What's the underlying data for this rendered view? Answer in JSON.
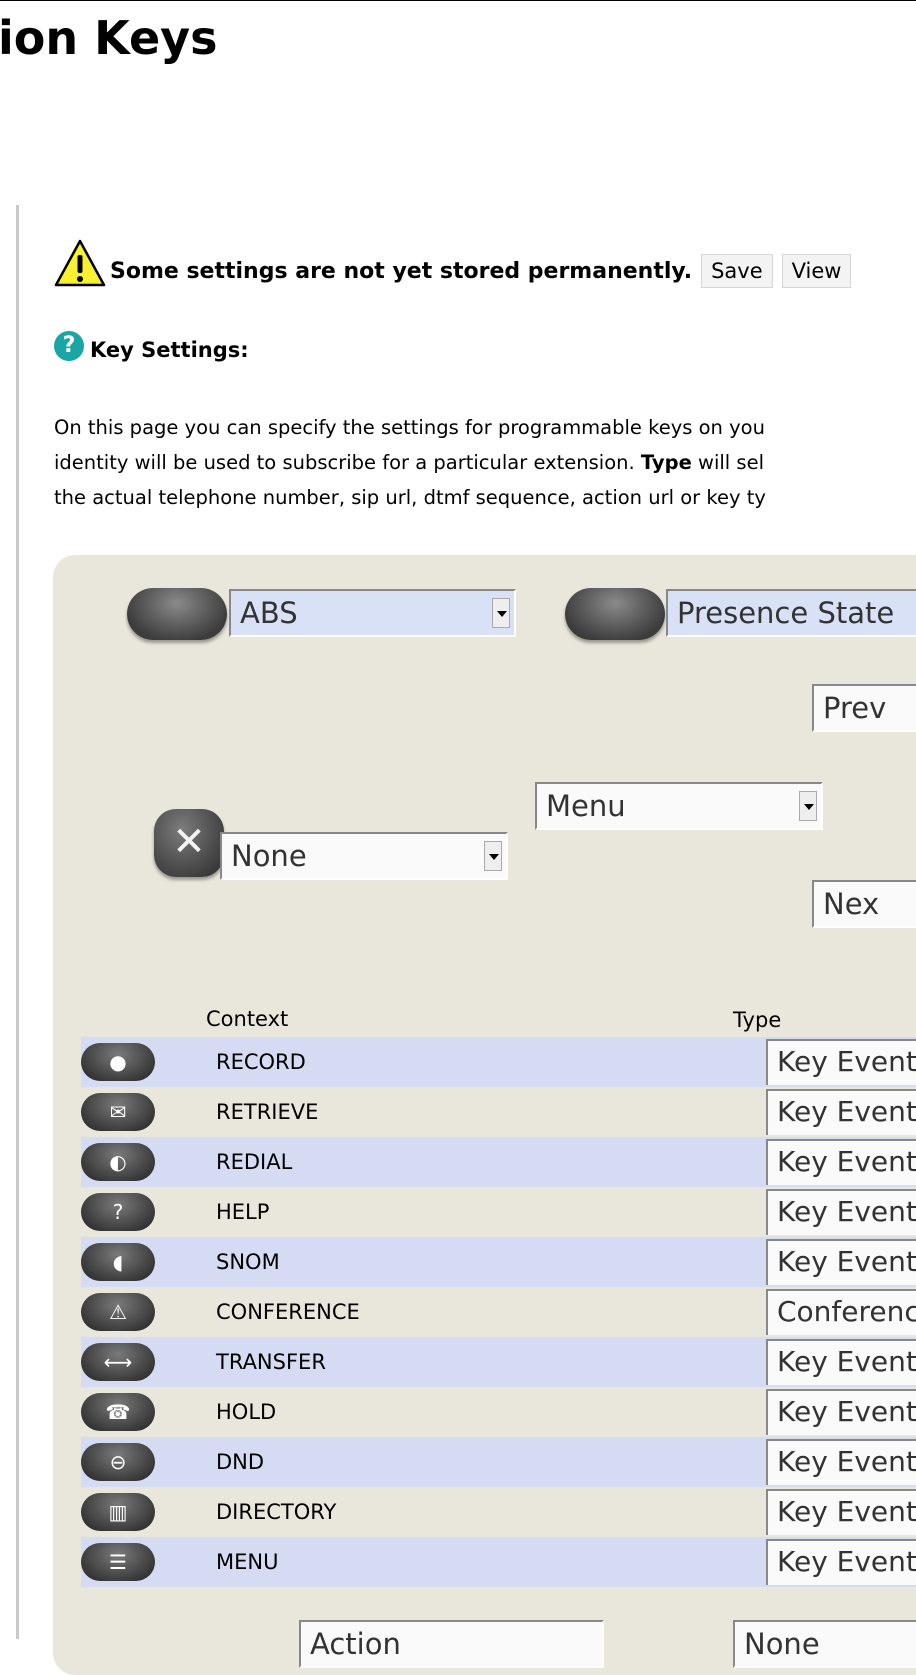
{
  "page": {
    "title": "ion Keys"
  },
  "warning": {
    "icon": "warning-icon",
    "text": "Some settings are not yet stored permanently.",
    "save_label": "Save",
    "view_label": "View"
  },
  "help": {
    "icon": "help-icon",
    "label": "Key Settings:"
  },
  "description": [
    "On this page you can specify the settings for programmable keys on you",
    "identity will be used to subscribe for a particular extension.",
    "Type",
    " will sel",
    "the actual telephone number, sip url, dtmf sequence, action url or key ty"
  ],
  "keypad": {
    "left_pill_select": "ABS",
    "right_pill_select": "Presence State",
    "prev_select": "Prev",
    "menu_select": "Menu",
    "cancel_select": "None",
    "next_select": "Nex",
    "cancel_key_icon": "✕"
  },
  "table": {
    "context_header": "Context",
    "type_header": "Type",
    "rows": [
      {
        "icon": "record-icon",
        "glyph": "●",
        "context": "RECORD",
        "type": "Key Event"
      },
      {
        "icon": "retrieve-icon",
        "glyph": "✉",
        "context": "RETRIEVE",
        "type": "Key Event"
      },
      {
        "icon": "redial-icon",
        "glyph": "◐",
        "context": "REDIAL",
        "type": "Key Event"
      },
      {
        "icon": "help-icon",
        "glyph": "?",
        "context": "HELP",
        "type": "Key Event"
      },
      {
        "icon": "snom-icon",
        "glyph": "◖",
        "context": "SNOM",
        "type": "Key Event"
      },
      {
        "icon": "conference-icon",
        "glyph": "⚠",
        "context": "CONFERENCE",
        "type": "Conferenc"
      },
      {
        "icon": "transfer-icon",
        "glyph": "⟷",
        "context": "TRANSFER",
        "type": "Key Event"
      },
      {
        "icon": "hold-icon",
        "glyph": "☎",
        "context": "HOLD",
        "type": "Key Event"
      },
      {
        "icon": "dnd-icon",
        "glyph": "⊖",
        "context": "DND",
        "type": "Key Event"
      },
      {
        "icon": "directory-icon",
        "glyph": "▥",
        "context": "DIRECTORY",
        "type": "Key Event"
      },
      {
        "icon": "menu-icon",
        "glyph": "☰",
        "context": "MENU",
        "type": "Key Event"
      }
    ]
  },
  "bottom": {
    "left_select": "Action",
    "right_select": "None"
  }
}
